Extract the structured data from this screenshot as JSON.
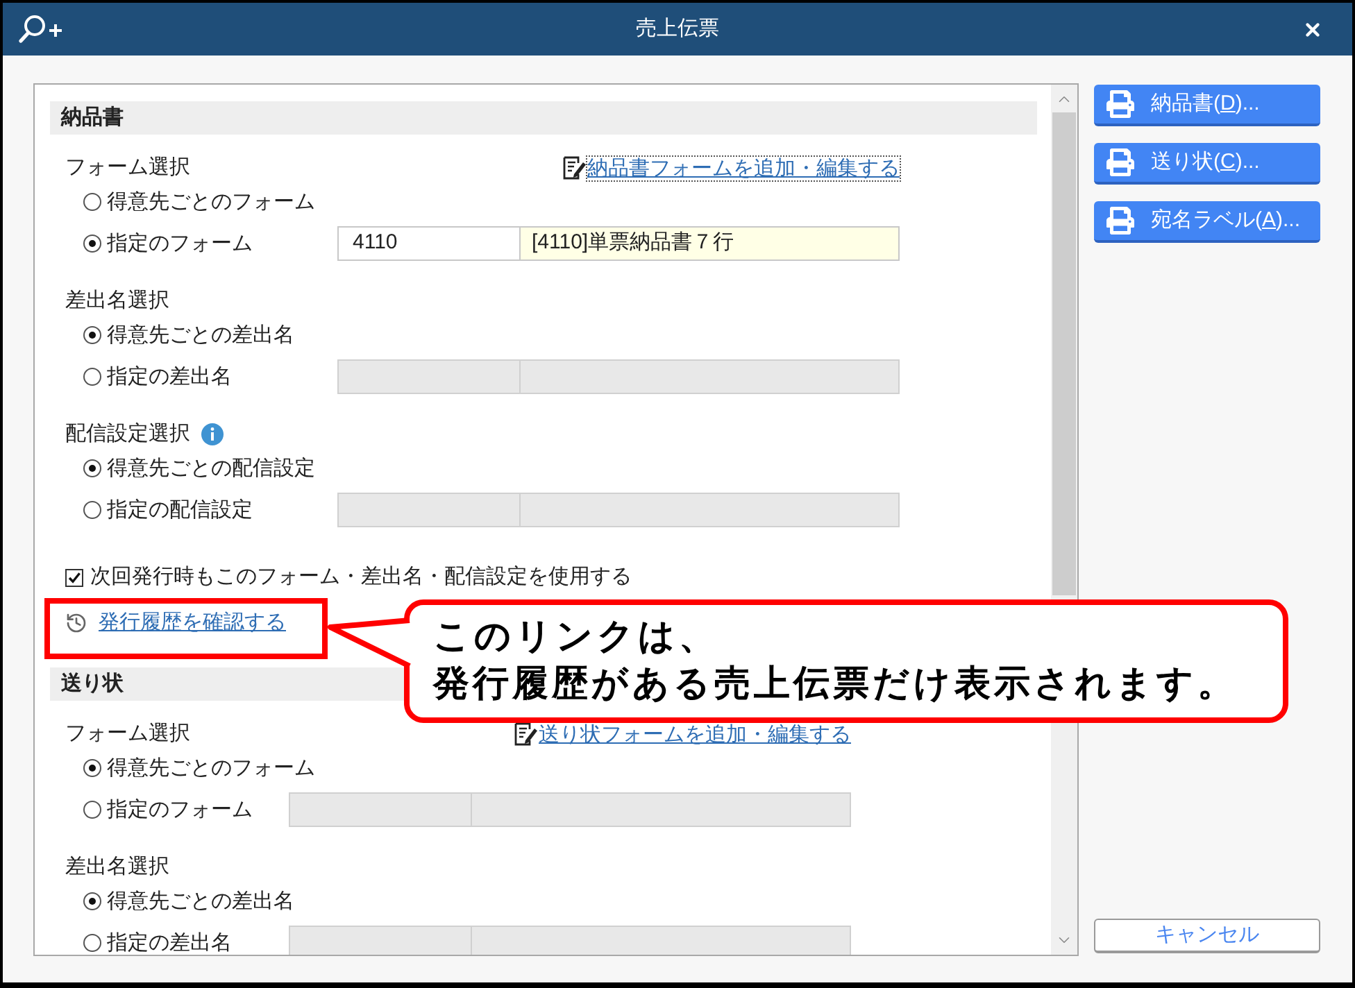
{
  "window": {
    "title": "売上伝票"
  },
  "sections": [
    {
      "title": "納品書",
      "groups": [
        {
          "label": "フォーム選択",
          "link": {
            "text": "納品書フォームを追加・編集する",
            "focused": true
          },
          "options": [
            {
              "label": "得意先ごとのフォーム",
              "selected": false
            },
            {
              "label": "指定のフォーム",
              "selected": true,
              "field": {
                "disabled": false,
                "code": "4110",
                "name": "[4110]単票納品書７行"
              }
            }
          ]
        },
        {
          "label": "差出名選択",
          "options": [
            {
              "label": "得意先ごとの差出名",
              "selected": true
            },
            {
              "label": "指定の差出名",
              "selected": false,
              "field": {
                "disabled": true
              }
            }
          ]
        },
        {
          "label": "配信設定選択",
          "info": true,
          "options": [
            {
              "label": "得意先ごとの配信設定",
              "selected": true
            },
            {
              "label": "指定の配信設定",
              "selected": false,
              "field": {
                "disabled": true
              }
            }
          ]
        }
      ],
      "remember": {
        "label": "次回発行時もこのフォーム・差出名・配信設定を使用する",
        "checked": true
      },
      "history_link": "発行履歴を確認する"
    },
    {
      "title": "送り状",
      "groups": [
        {
          "label": "フォーム選択",
          "link": {
            "text": "送り状フォームを追加・編集する",
            "focused": false
          },
          "options": [
            {
              "label": "得意先ごとのフォーム",
              "selected": true
            },
            {
              "label": "指定のフォーム",
              "selected": false,
              "field": {
                "disabled": true
              }
            }
          ]
        },
        {
          "label": "差出名選択",
          "options": [
            {
              "label": "得意先ごとの差出名",
              "selected": true
            },
            {
              "label": "指定の差出名",
              "selected": false,
              "field": {
                "disabled": true
              }
            }
          ]
        }
      ]
    }
  ],
  "print_buttons": [
    {
      "before": "納品書(",
      "mnemonic": "D",
      "after": ")..."
    },
    {
      "before": "送り状(",
      "mnemonic": "C",
      "after": ")..."
    },
    {
      "before": "宛名ラベル(",
      "mnemonic": "A",
      "after": ")..."
    }
  ],
  "cancel_button": "キャンセル",
  "callout": {
    "lines": [
      "このリンクは、",
      "発行履歴がある売上伝票だけ表示されます。"
    ]
  }
}
